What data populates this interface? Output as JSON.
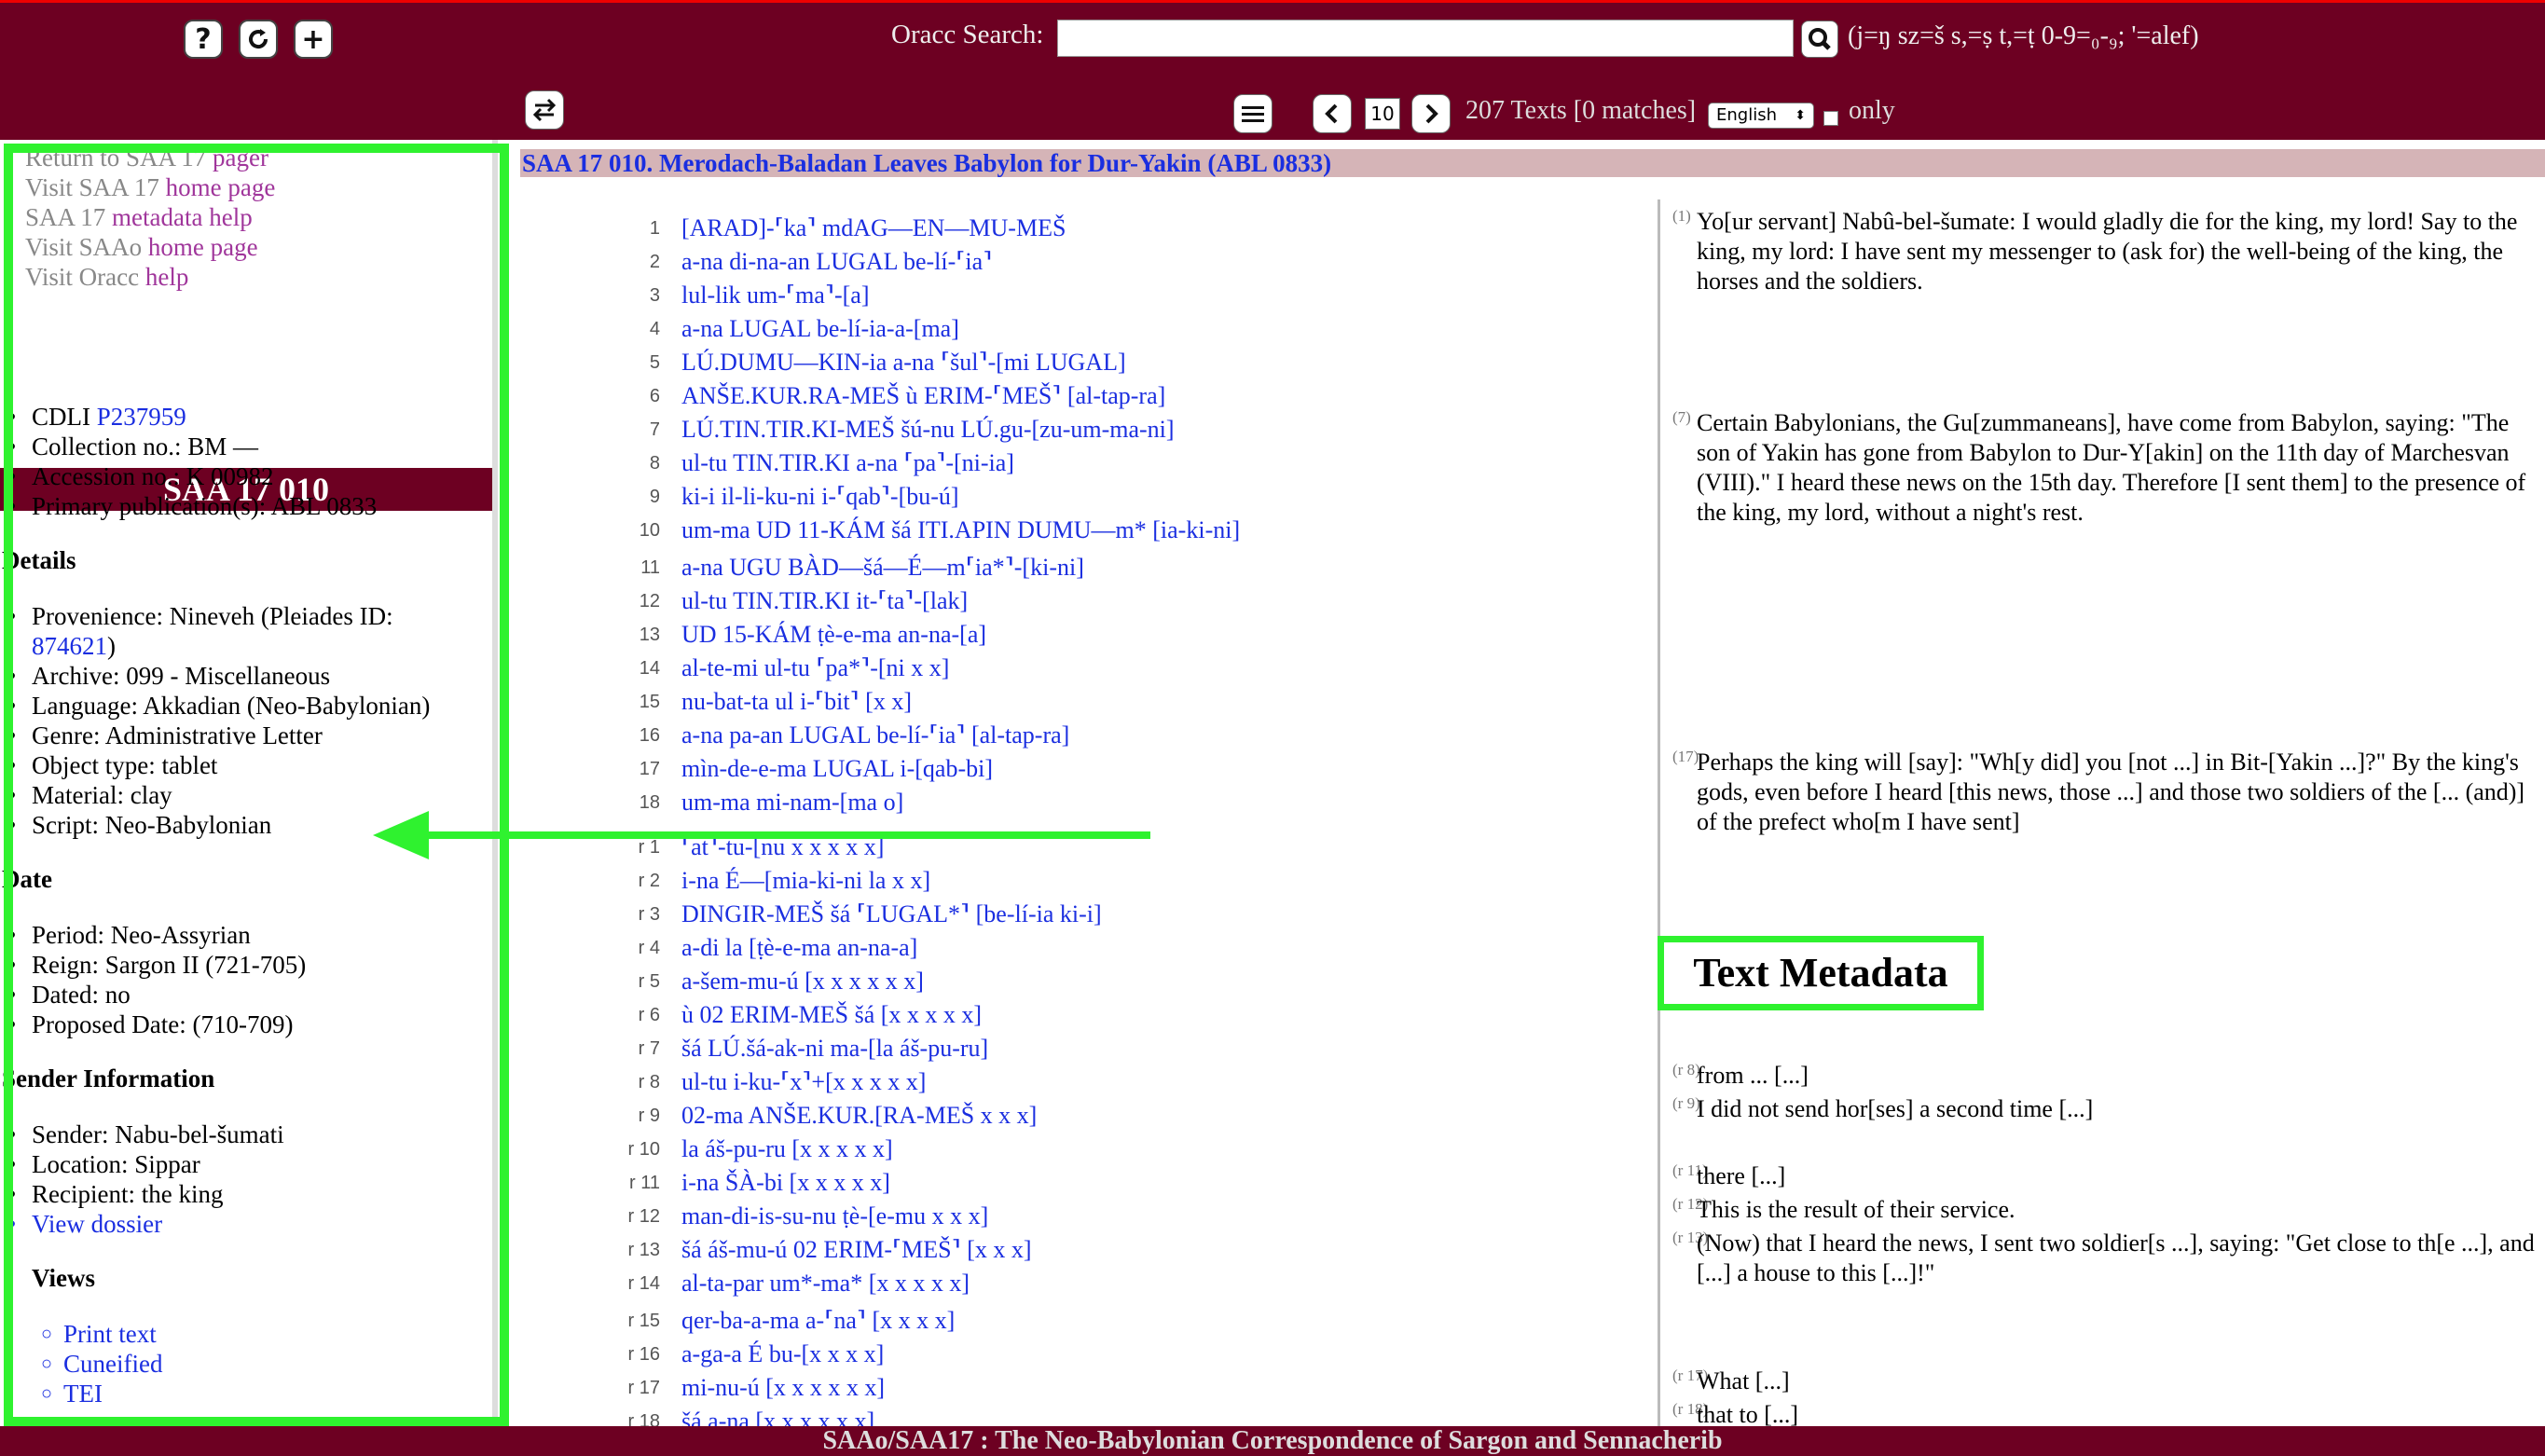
{
  "header": {
    "search_label": "Oracc Search:",
    "search_value": "",
    "search_hint": "(j=ŋ sz=š s,=ṣ t,=ṭ 0-9=₀-₉; '=alef)",
    "page_number": "10",
    "texts_count": "207 Texts [0 matches]",
    "language": "English",
    "only_label": "only"
  },
  "sidebar": {
    "links": [
      {
        "prefix": "Return to SAA 17 ",
        "link": "pager"
      },
      {
        "prefix": "Visit SAA 17 ",
        "link": "home page"
      },
      {
        "prefix": "SAA 17 ",
        "link": "metadata help"
      },
      {
        "prefix": "Visit SAAo ",
        "link": "home page"
      },
      {
        "prefix": "Visit Oracc ",
        "link": "help"
      }
    ],
    "title": "SAA 17 010",
    "cdli_label": "CDLI ",
    "cdli_value": "P237959",
    "collection": "Collection no.: BM —",
    "accession": "Accession no.: K 00982",
    "primary_pub": "Primary publication(s): ABL 0833",
    "details_heading": "Details",
    "provenience_label": "Provenience: Nineveh (Pleiades ID:",
    "provenience_id": "874621",
    "provenience_close": ")",
    "archive": "Archive: 099 - Miscellaneous",
    "language": "Language: Akkadian (Neo-Babylonian)",
    "genre": "Genre: Administrative Letter",
    "object_type": "Object type: tablet",
    "material": "Material: clay",
    "script": "Script: Neo-Babylonian",
    "date_heading": "Date",
    "period": "Period: Neo-Assyrian",
    "reign": "Reign: Sargon II (721-705)",
    "dated": "Dated: no",
    "proposed_date": "Proposed Date: (710-709)",
    "sender_heading": "Sender Information",
    "sender": "Sender: Nabu-bel-šumati",
    "location": "Location: Sippar",
    "recipient": "Recipient: the king",
    "dossier": "View dossier",
    "views_heading": "Views",
    "views": [
      "Print text",
      "Cuneified",
      "TEI"
    ]
  },
  "main": {
    "title": "SAA 17 010. Merodach-Baladan Leaves Babylon for Dur-Yakin (ABL 0833)",
    "lines": [
      {
        "n": "1",
        "t": "[ARAD]-⸢ka⸣ mdAG—EN—MU-MEŠ"
      },
      {
        "n": "2",
        "t": "a-na di-na-an LUGAL be-lí-⸢ia⸣"
      },
      {
        "n": "3",
        "t": "lul-lik um-⸢ma⸣-[a]"
      },
      {
        "n": "4",
        "t": "a-na LUGAL be-lí-ia-a-[ma]"
      },
      {
        "n": "5",
        "t": "LÚ.DUMU—KIN-ia a-na ⸢šul⸣-[mi LUGAL]"
      },
      {
        "n": "6",
        "t": "ANŠE.KUR.RA-MEŠ ù ERIM-⸢MEŠ⸣ [al-tap-ra]"
      },
      {
        "n": "7",
        "t": "LÚ.TIN.TIR.KI-MEŠ šú-nu LÚ.gu-[zu-um-ma-ni]"
      },
      {
        "n": "8",
        "t": "ul-tu TIN.TIR.KI a-na ⸢pa⸣-[ni-ia]"
      },
      {
        "n": "9",
        "t": "ki-i il-li-ku-ni i-⸢qab⸣-[bu-ú]"
      },
      {
        "n": "10",
        "t": "um-ma UD 11-KÁM šá ITI.APIN DUMU—m* [ia-ki-ni]"
      },
      {
        "n": "11",
        "t": "a-na UGU BÀD—šá—É—m⸢ia*⸣-[ki-ni]"
      },
      {
        "n": "12",
        "t": "ul-tu TIN.TIR.KI it-⸢ta⸣-[lak]"
      },
      {
        "n": "13",
        "t": "UD 15-KÁM ṭè-e-ma an-na-[a]"
      },
      {
        "n": "14",
        "t": "al-te-mi ul-tu ⸢pa*⸣-[ni x x]"
      },
      {
        "n": "15",
        "t": "nu-bat-ta ul i-⸢bit⸣ [x x]"
      },
      {
        "n": "16",
        "t": "a-na pa-an LUGAL be-lí-⸢ia⸣ [al-tap-ra]"
      },
      {
        "n": "17",
        "t": "mìn-de-e-ma LUGAL i-[qab-bi]"
      },
      {
        "n": "18",
        "t": "um-ma mi-nam-[ma o]"
      },
      {
        "n": "r 1",
        "t": "⸢at⸣-tu-[nu x x x x x]"
      },
      {
        "n": "r 2",
        "t": "i-na É—[mia-ki-ni la x x]"
      },
      {
        "n": "r 3",
        "t": "DINGIR-MEŠ šá ⸢LUGAL*⸣ [be-lí-ia ki-i]"
      },
      {
        "n": "r 4",
        "t": "a-di la [ṭè-e-ma an-na-a]"
      },
      {
        "n": "r 5",
        "t": "a-šem-mu-ú [x x x x x x]"
      },
      {
        "n": "r 6",
        "t": "ù 02 ERIM-MEŠ šá [x x x x x]"
      },
      {
        "n": "r 7",
        "t": "šá LÚ.šá-ak-ni ma-[la áš-pu-ru]"
      },
      {
        "n": "r 8",
        "t": "ul-tu i-ku-⸢x⸣+[x x x x x]"
      },
      {
        "n": "r 9",
        "t": "02-ma ANŠE.KUR.[RA-MEŠ x x x]"
      },
      {
        "n": "r 10",
        "t": "la áš-pu-ru [x x x x x]"
      },
      {
        "n": "r 11",
        "t": "i-na ŠÀ-bi [x x x x x]"
      },
      {
        "n": "r 12",
        "t": "man-di-is-su-nu ṭè-[e-mu x x x]"
      },
      {
        "n": "r 13",
        "t": "šá áš-mu-ú 02 ERIM-⸢MEŠ⸣ [x x x]"
      },
      {
        "n": "r 14",
        "t": "al-ta-par um*-ma* [x x x x x]"
      },
      {
        "n": "r 15",
        "t": "qer-ba-a-ma a-⸢na⸣ [x x x x]"
      },
      {
        "n": "r 16",
        "t": "a-ga-a É bu-[x x x x]"
      },
      {
        "n": "r 17",
        "t": "mi-nu-ú [x x x x x x]"
      },
      {
        "n": "r 18",
        "t": "šá a-na [x x x x x x]"
      }
    ],
    "translations": [
      {
        "n": "(1)",
        "t": "Yo[ur servant] Nabû-bel-šumate: I would gladly die for the king, my lord! Say to the king, my lord: I have sent my messenger to (ask for) the well-being of the king, the horses and the soldiers."
      },
      {
        "n": "(7)",
        "t": "Certain Babylonians, the Gu[zummaneans], have come from Babylon, saying: \"The son of Yakin has gone from Babylon to Dur-Y[akin] on the 11th day of Marchesvan (VIII).\" I heard these news on the 15th day. Therefore [I sent them] to the presence of the king, my lord, without a night's rest."
      },
      {
        "n": "(17)",
        "t": "Perhaps the king will [say]: \"Wh[y did] you [not ...] in Bit-[Yakin ...]?\" By the king's gods, even before I heard [this news, those ...] and those two soldiers of the [... (and)] of the prefect who[m I have sent]"
      },
      {
        "n": "(r 8)",
        "t": "from ... [...]"
      },
      {
        "n": "(r 9)",
        "t": "I did not send hor[ses] a second time [...]"
      },
      {
        "n": "(r 11)",
        "t": "there [...]"
      },
      {
        "n": "(r 12)",
        "t": "This is the result of their service."
      },
      {
        "n": "(r 13)",
        "t": "(Now) that I heard the news, I sent two soldier[s ...], saying: \"Get close to th[e ...], and [...] a house to this [...]!\""
      },
      {
        "n": "(r 17)",
        "t": "What [...]"
      },
      {
        "n": "(r 18)",
        "t": "that to [...]"
      }
    ]
  },
  "annotation": {
    "label": "Text Metadata"
  },
  "footer": {
    "text": "SAAo/SAA17 : The Neo-Babylonian Correspondence of Sargon and Sennacherib"
  },
  "colors": {
    "header_bg": "#6d0022",
    "highlight": "#2ff22f",
    "link": "#1a2ee0",
    "title_bar": "#d5b4b7"
  },
  "icons": [
    "help-icon",
    "reload-icon",
    "add-icon",
    "swap-icon",
    "menu-icon",
    "prev-icon",
    "next-icon",
    "search-icon",
    "arrow-icon"
  ]
}
